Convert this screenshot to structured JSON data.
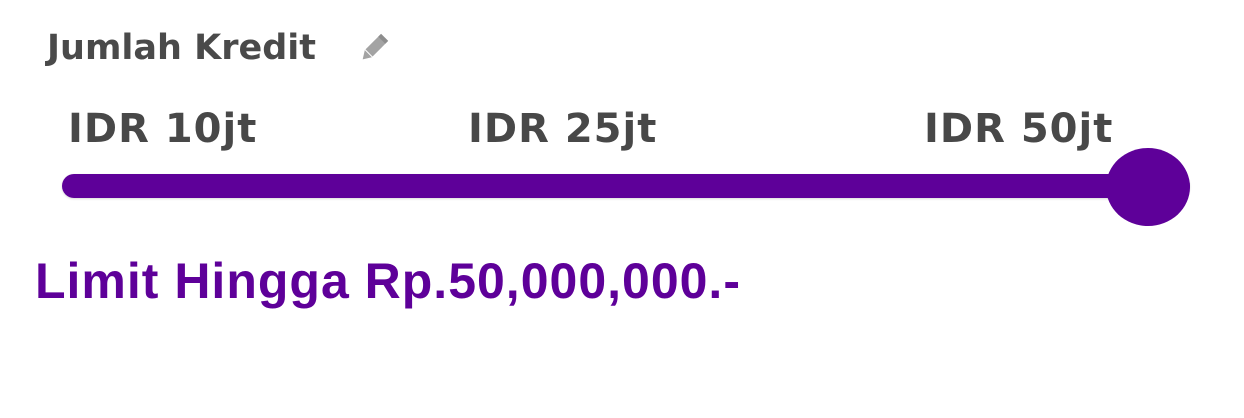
{
  "header": {
    "title": "Jumlah Kredit",
    "edit_icon": "pencil-icon"
  },
  "slider": {
    "ticks": [
      "IDR 10jt",
      "IDR 25jt",
      "IDR 50jt"
    ],
    "value_fraction": 1.0,
    "selected_label": "IDR 50jt",
    "color": "#5e0099"
  },
  "limit": {
    "text": "Limit Hingga Rp.50,000,000.-",
    "color": "#5e0099"
  },
  "colors": {
    "title": "#4a4a4a",
    "tick_label": "#484848",
    "accent": "#5e0099"
  }
}
